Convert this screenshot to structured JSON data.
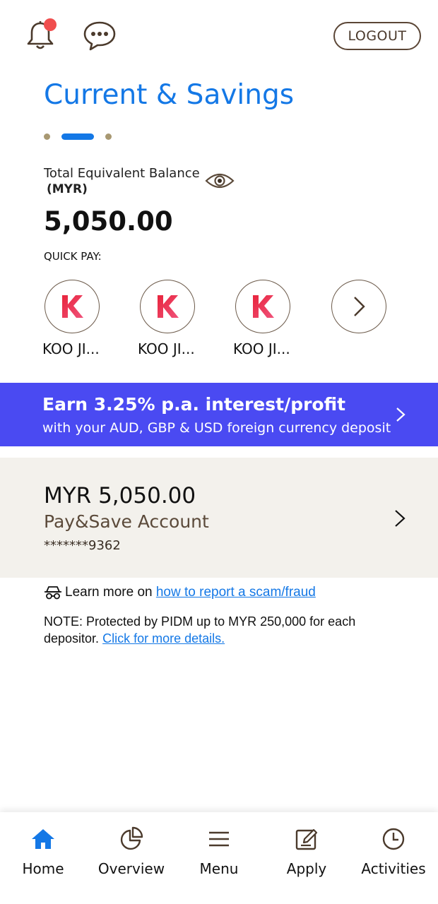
{
  "header": {
    "logout_label": "LOGOUT"
  },
  "page": {
    "title": "Current & Savings"
  },
  "balance": {
    "label": "Total Equivalent Balance",
    "currency": "(MYR)",
    "amount": "5,050.00"
  },
  "quick_pay": {
    "label": "QUICK PAY:",
    "items": [
      {
        "initial": "K",
        "name": "KOO JI..."
      },
      {
        "initial": "K",
        "name": "KOO JI..."
      },
      {
        "initial": "K",
        "name": "KOO JI..."
      }
    ]
  },
  "promo": {
    "title": "Earn 3.25% p.a. interest/profit",
    "subtitle": "with your AUD, GBP & USD foreign currency deposit"
  },
  "account": {
    "amount": "MYR 5,050.00",
    "name": "Pay&Save Account",
    "number": "*******9362"
  },
  "scam": {
    "prefix": "Learn more on",
    "link": "how to report a scam/fraud"
  },
  "note": {
    "text": "NOTE: Protected by PIDM up to MYR 250,000 for each depositor.",
    "link": "Click for more details."
  },
  "nav": {
    "items": [
      {
        "label": "Home",
        "icon": "home-icon"
      },
      {
        "label": "Overview",
        "icon": "pie-chart-icon"
      },
      {
        "label": "Menu",
        "icon": "hamburger-menu-icon"
      },
      {
        "label": "Apply",
        "icon": "edit-icon"
      },
      {
        "label": "Activities",
        "icon": "clock-icon"
      }
    ]
  },
  "colors": {
    "brand_blue": "#1478e6",
    "promo_bg": "#4a4af2",
    "account_bg": "#f3f1ec",
    "notification_dot": "#f04e4e"
  }
}
